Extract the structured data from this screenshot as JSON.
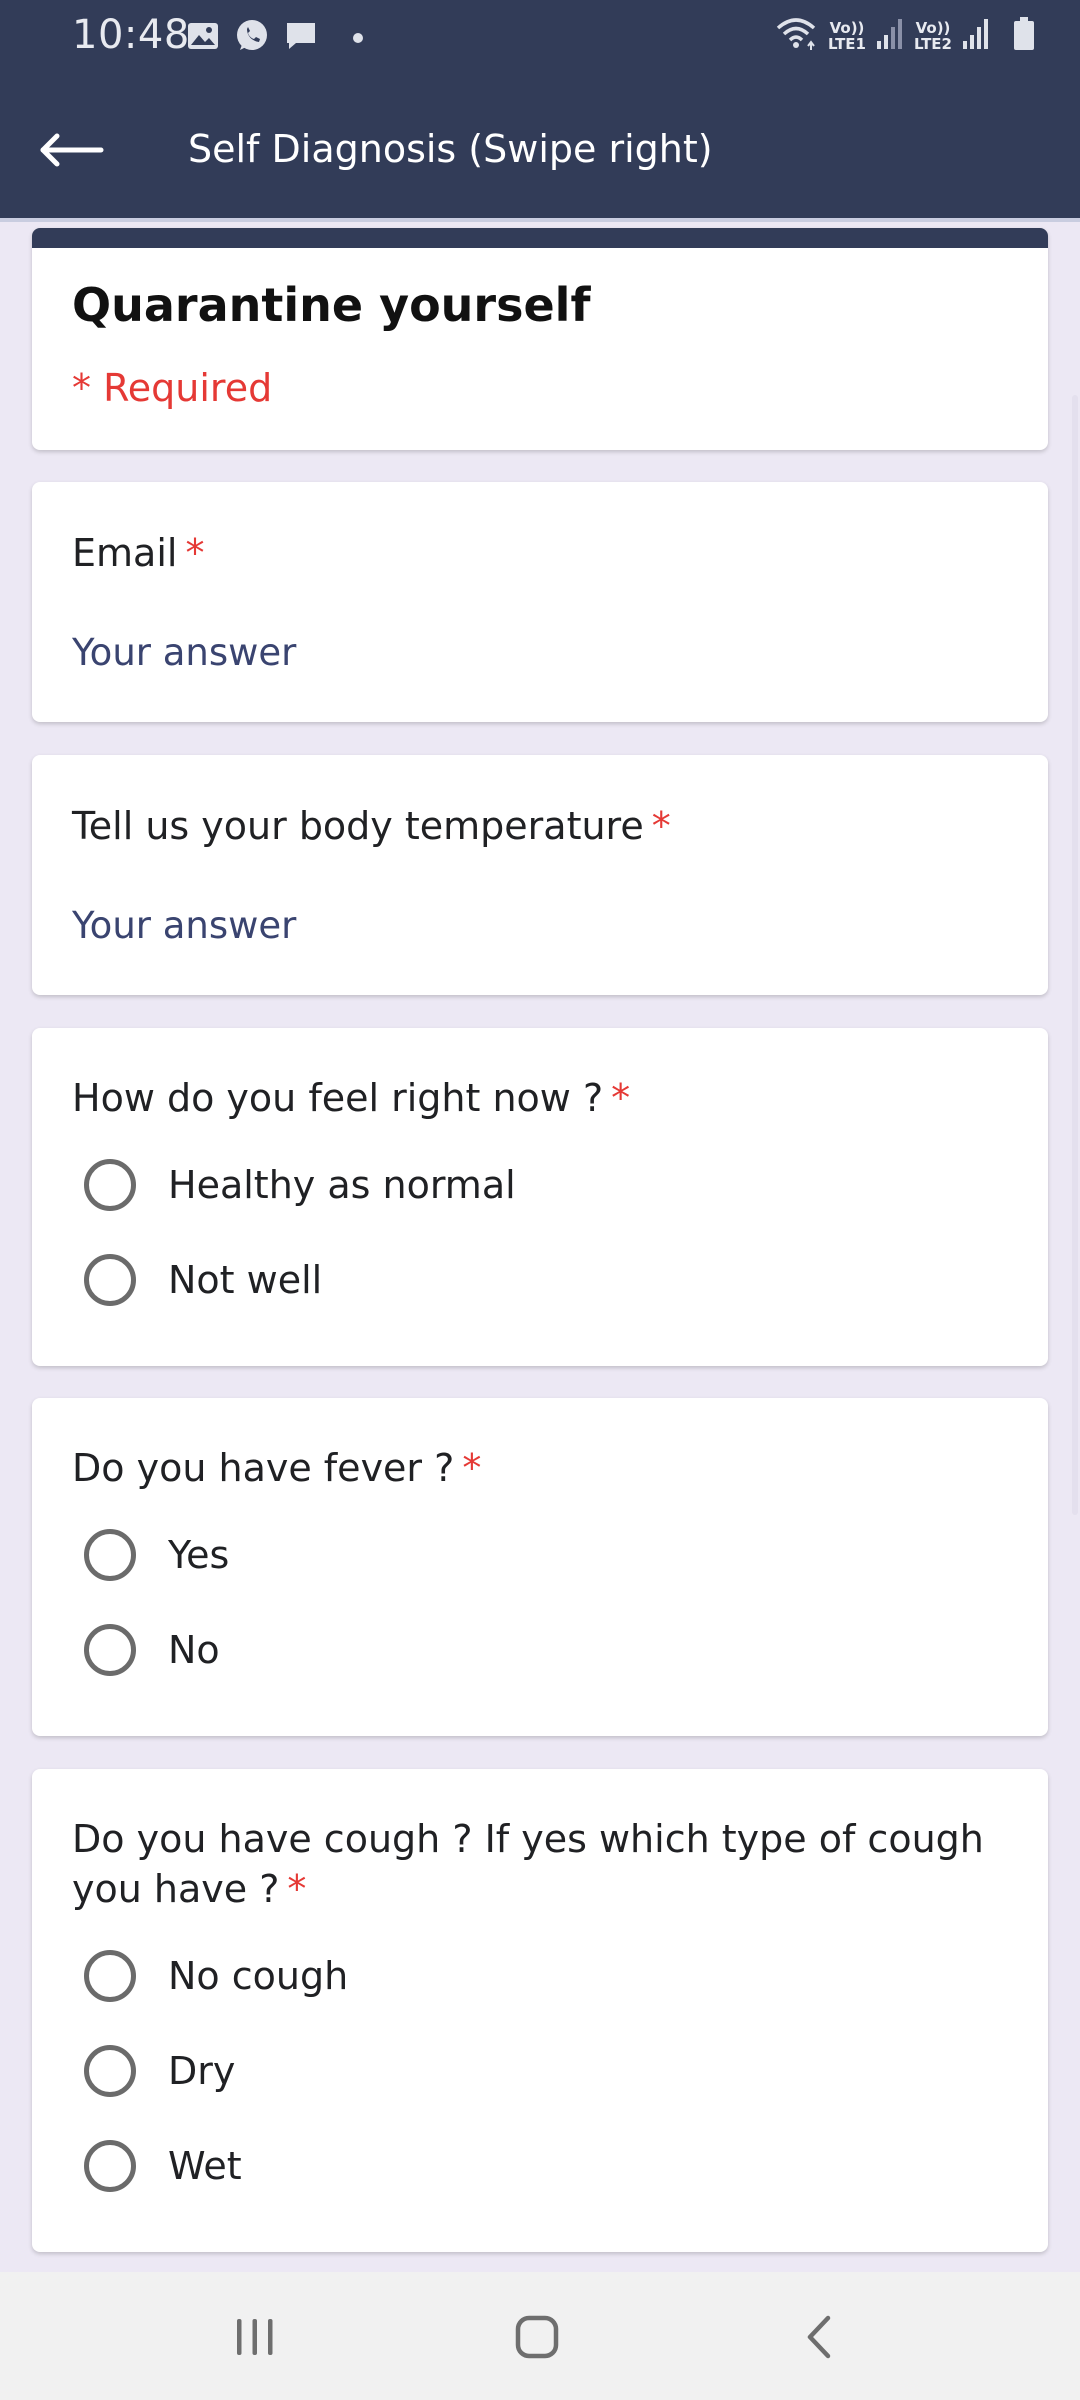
{
  "status_bar": {
    "time": "10:48",
    "left_icons": [
      "gallery-icon",
      "whatsapp-icon",
      "message-icon",
      "dot-icon"
    ],
    "right_icons": [
      "wifi-icon",
      "signal-icon",
      "signal-icon",
      "battery-icon"
    ],
    "lte1_top": "Vo))",
    "lte1_bottom": "LTE1",
    "lte2_top": "Vo))",
    "lte2_bottom": "LTE2"
  },
  "app_bar": {
    "title": "Self Diagnosis (Swipe right)",
    "back_icon": "arrow-left-icon"
  },
  "form": {
    "title": "Quarantine yourself",
    "required_note": "* Required",
    "required_marker": "*",
    "questions": [
      {
        "label": "Email",
        "type": "text",
        "placeholder": "Your answer"
      },
      {
        "label": "Tell us your body temperature",
        "type": "text",
        "placeholder": "Your answer"
      },
      {
        "label": "How do you feel right now ?",
        "type": "radio",
        "options": [
          "Healthy as normal",
          "Not well"
        ]
      },
      {
        "label": "Do you have fever ?",
        "type": "radio",
        "options": [
          "Yes",
          "No"
        ]
      },
      {
        "label_line1": "Do you have cough ? If yes which type of cough",
        "label_line2": "you have ?",
        "type": "radio",
        "options": [
          "No cough",
          "Dry",
          "Wet"
        ]
      }
    ]
  },
  "nav_bar": {
    "buttons": [
      "recent-apps-icon",
      "home-icon",
      "back-icon"
    ]
  },
  "colors": {
    "header": "#323c58",
    "background": "#ece8f4",
    "required": "#e53935",
    "placeholder": "#3a4470"
  }
}
